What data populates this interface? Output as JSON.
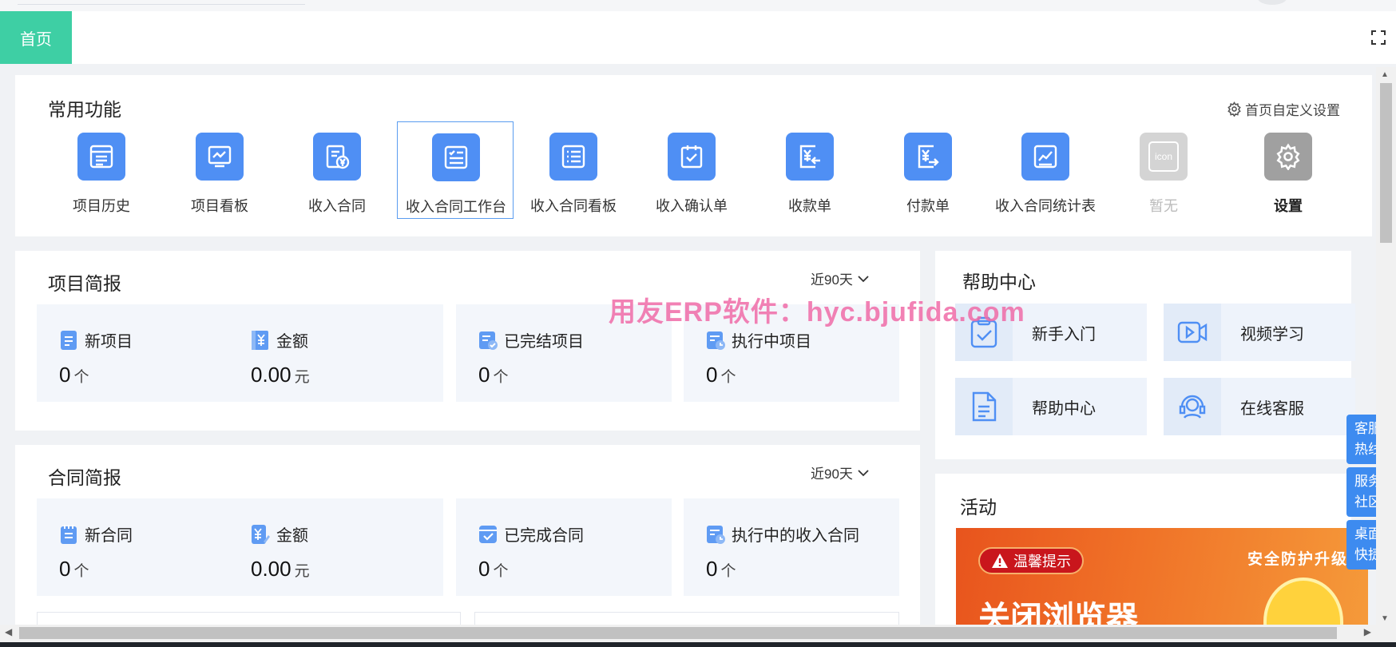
{
  "tabs": {
    "home": "首页"
  },
  "common": {
    "title": "常用功能",
    "settings_link": "首页自定义设置",
    "items": [
      {
        "label": "项目历史",
        "icon": "list-doc-icon"
      },
      {
        "label": "项目看板",
        "icon": "dashboard-icon"
      },
      {
        "label": "收入合同",
        "icon": "contract-yen-icon"
      },
      {
        "label": "收入合同工作台",
        "icon": "checklist-icon"
      },
      {
        "label": "收入合同看板",
        "icon": "list-icon"
      },
      {
        "label": "收入确认单",
        "icon": "clipboard-check-icon"
      },
      {
        "label": "收款单",
        "icon": "yen-in-icon"
      },
      {
        "label": "付款单",
        "icon": "yen-out-icon"
      },
      {
        "label": "收入合同统计表",
        "icon": "chart-icon"
      },
      {
        "label": "暂无",
        "icon": "placeholder-icon",
        "icon_text": "icon"
      },
      {
        "label": "设置",
        "icon": "gear-icon"
      }
    ]
  },
  "project_brief": {
    "title": "项目简报",
    "period": "近90天",
    "stats": [
      {
        "label": "新项目",
        "value": "0",
        "unit": "个"
      },
      {
        "label": "金额",
        "value": "0.00",
        "unit": "元"
      },
      {
        "label": "已完结项目",
        "value": "0",
        "unit": "个"
      },
      {
        "label": "执行中项目",
        "value": "0",
        "unit": "个"
      }
    ]
  },
  "contract_brief": {
    "title": "合同简报",
    "period": "近90天",
    "stats": [
      {
        "label": "新合同",
        "value": "0",
        "unit": "个"
      },
      {
        "label": "金额",
        "value": "0.00",
        "unit": "元"
      },
      {
        "label": "已完成合同",
        "value": "0",
        "unit": "个"
      },
      {
        "label": "执行中的收入合同",
        "value": "0",
        "unit": "个"
      }
    ]
  },
  "help": {
    "title": "帮助中心",
    "items": [
      {
        "label": "新手入门"
      },
      {
        "label": "视频学习"
      },
      {
        "label": "帮助中心"
      },
      {
        "label": "在线客服"
      }
    ]
  },
  "activity": {
    "title": "活动",
    "banner": {
      "tip": "温馨提示",
      "headline": "关闭浏览器",
      "upgrade": "安全防护升级"
    }
  },
  "side_buttons": [
    {
      "line1": "客服",
      "line2": "热线"
    },
    {
      "line1": "服务",
      "line2": "社区"
    },
    {
      "line1": "桌面",
      "line2": "快捷"
    }
  ],
  "watermark": "用友ERP软件：hyc.bjufida.com",
  "colors": {
    "accent": "#4f8ff4",
    "tab_active": "#3ecfa4",
    "side_button": "#3d8bf0"
  }
}
